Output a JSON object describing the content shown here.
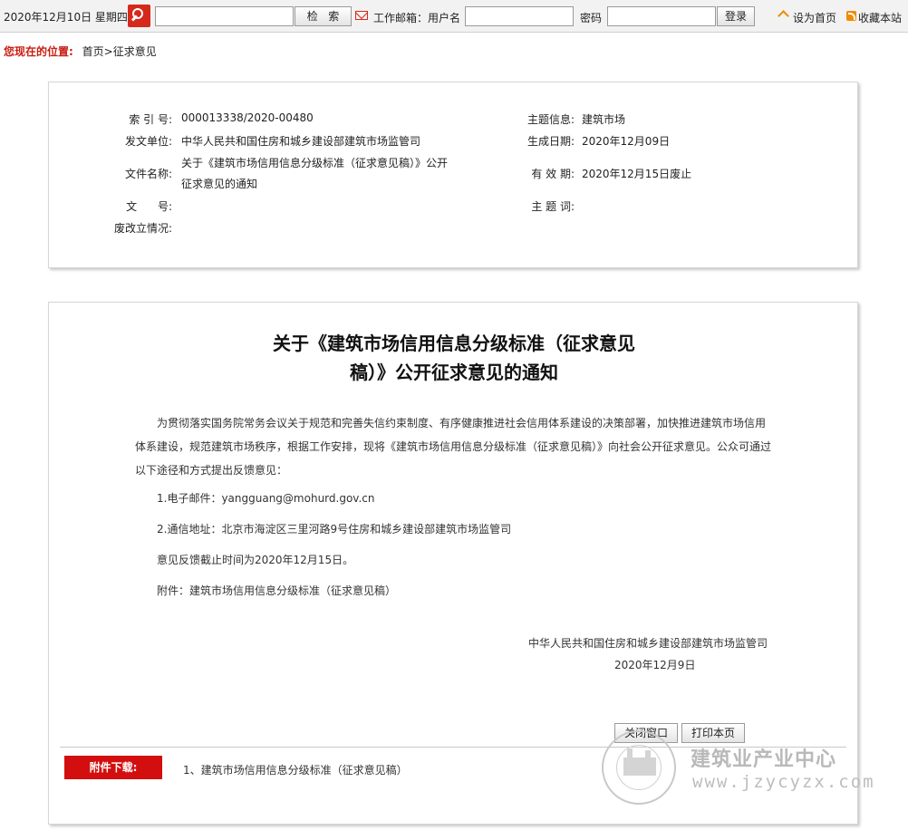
{
  "topbar": {
    "date": "2020年12月10日  星期四",
    "search_button": "检   索",
    "mail_label": "工作邮箱：用户名",
    "password_label": "密码",
    "login_button": "登录",
    "set_home": "设为首页",
    "favorite": "收藏本站",
    "icons": [
      "search-icon",
      "mail-icon",
      "home-icon",
      "rss-icon"
    ]
  },
  "breadcrumb": {
    "here": "您现在的位置:",
    "path": "首页>征求意见"
  },
  "info": {
    "index_label": "索 引 号:",
    "index_value": "000013338/2020-00480",
    "unit_label": "发文单位:",
    "unit_value": "中华人民共和国住房和城乡建设部建筑市场监管司",
    "filename_label": "文件名称:",
    "filename_value_line1": "关于《建筑市场信用信息分级标准（征求意见稿）》公开",
    "filename_value_line2": "征求意见的通知",
    "docno_label": "文      号:",
    "docno_value": "",
    "status_label": "废改立情况:",
    "status_value": "",
    "topic_label": "主题信息:",
    "topic_value": "建筑市场",
    "created_label": "生成日期:",
    "created_value": "2020年12月09日",
    "valid_label": "有 效 期:",
    "valid_value": "2020年12月15日废止",
    "keywords_label": "主 题 词:",
    "keywords_value": ""
  },
  "document": {
    "title_line1": "关于《建筑市场信用信息分级标准（征求意见",
    "title_line2": "稿）》公开征求意见的通知",
    "body": "为贯彻落实国务院常务会议关于规范和完善失信约束制度、有序健康推进社会信用体系建设的决策部署，加快推进建筑市场信用体系建设，规范建筑市场秩序，根据工作安排，现将《建筑市场信用信息分级标准（征求意见稿）》向社会公开征求意见。公众可通过以下途径和方式提出反馈意见：",
    "item1": "1.电子邮件：yangguang@mohurd.gov.cn",
    "item2": "2.通信地址：北京市海淀区三里河路9号住房和城乡建设部建筑市场监管司",
    "deadline": "意见反馈截止时间为2020年12月15日。",
    "attachment_note": "附件：建筑市场信用信息分级标准（征求意见稿）",
    "signature": "中华人民共和国住房和城乡建设部建筑市场监管司",
    "sign_date": "2020年12月9日",
    "close_button": "关闭窗口",
    "print_button": "打印本页",
    "download_label": "附件下载:",
    "download_item": "1、建筑市场信用信息分级标准（征求意见稿）"
  },
  "watermark": {
    "cn": "建筑业产业中心",
    "en": "www.jzycyzx.com"
  },
  "colors": {
    "accent_red": "#d30e0e",
    "breadcrumb_red": "#c81d12",
    "icon_orange": "#f08a00"
  }
}
